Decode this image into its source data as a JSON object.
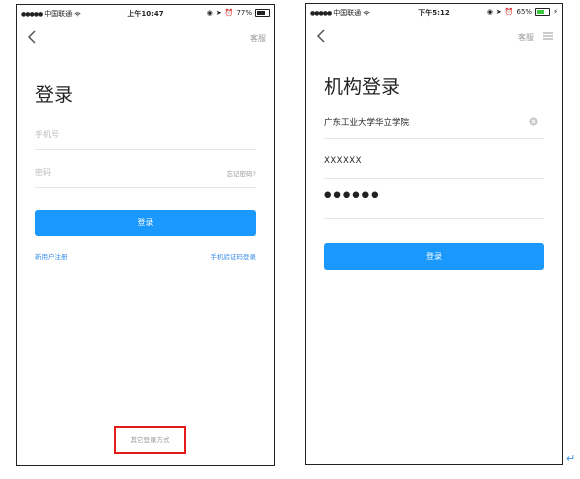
{
  "left_screen": {
    "status": {
      "carrier": "中国联通",
      "time": "上午10:47",
      "battery": "77%"
    },
    "nav": {
      "service": "客服"
    },
    "title": "登录",
    "phone_placeholder": "手机号",
    "password_placeholder": "密码",
    "forgot_password": "忘记密码?",
    "login_button": "登录",
    "register_link": "新用户注册",
    "sms_login_link": "手机验证码登录",
    "other_methods": "其它登录方式"
  },
  "right_screen": {
    "status": {
      "carrier": "中国联通",
      "time": "下午5:12",
      "battery": "65%"
    },
    "nav": {
      "service": "客服"
    },
    "title": "机构登录",
    "institution_value": "广东工业大学华立学院",
    "account_value": "XXXXXX",
    "password_value": "●●●●●●",
    "login_button": "登录"
  },
  "colors": {
    "primary": "#1a98fb",
    "link": "#3a8ee6",
    "highlight": "#e31b1b"
  },
  "icons": [
    "back-chevron-icon",
    "menu-icon",
    "clear-icon",
    "wifi-icon",
    "battery-icon"
  ]
}
